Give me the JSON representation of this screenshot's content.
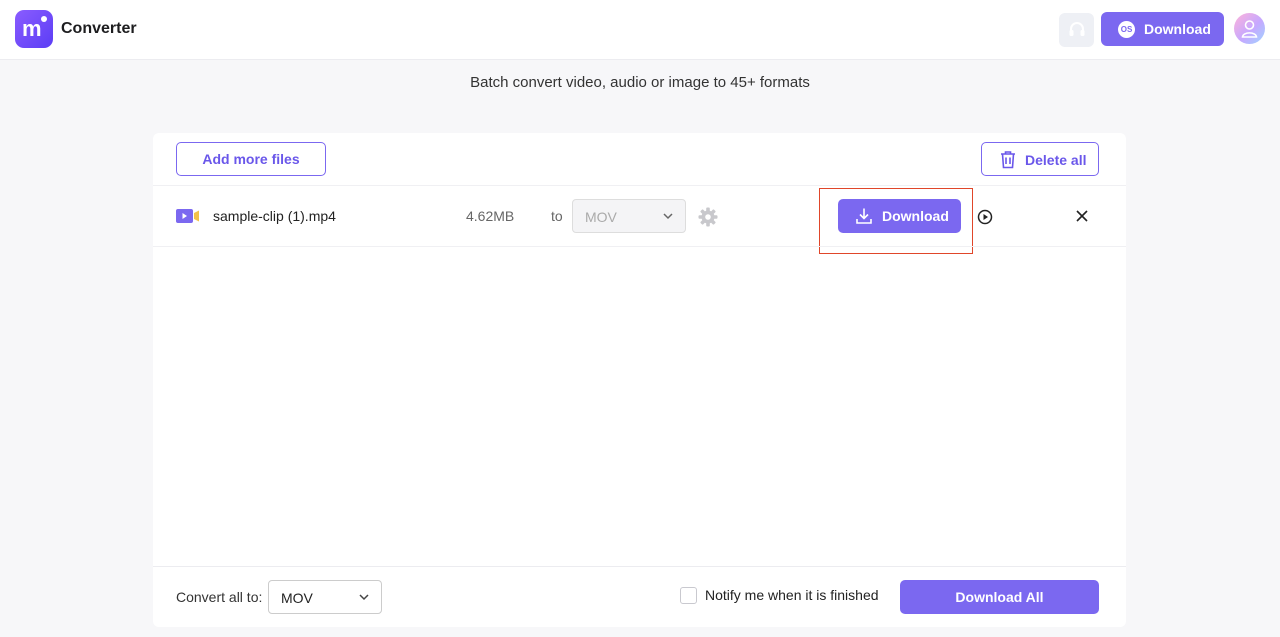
{
  "app": {
    "logo_letter": "m",
    "title": "Converter"
  },
  "header": {
    "support_icon": "headset-icon",
    "download_label": "Download",
    "os_badge": "OS",
    "avatar_icon": "user-icon"
  },
  "subtitle": "Batch convert video, audio or image to 45+ formats",
  "toolbar": {
    "add_files_label": "Add more files",
    "delete_all_label": "Delete all"
  },
  "files": [
    {
      "name": "sample-clip (1).mp4",
      "size": "4.62MB",
      "to_label": "to",
      "format": "MOV",
      "download_label": "Download"
    }
  ],
  "footer": {
    "convert_all_label": "Convert all to:",
    "convert_all_value": "MOV",
    "notify_label": "Notify me when it is finished",
    "notify_checked": false,
    "download_all_label": "Download All"
  },
  "colors": {
    "accent": "#7b68f0",
    "highlight": "#e0462a",
    "background": "#f7f7f9"
  }
}
